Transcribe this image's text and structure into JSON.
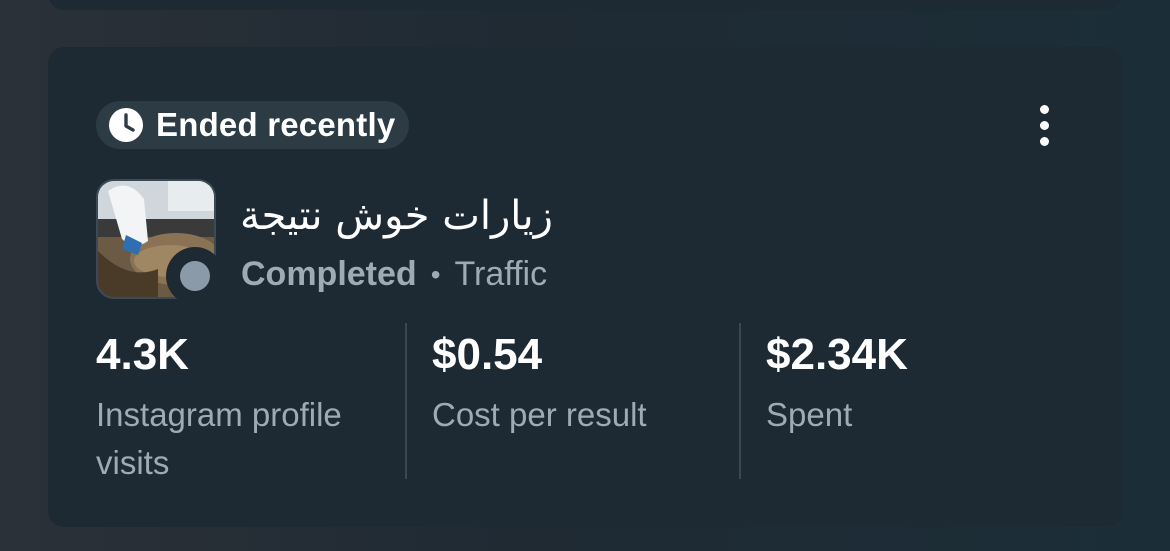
{
  "card": {
    "status_pill": {
      "label": "Ended recently",
      "icon": "clock-icon"
    },
    "menu_icon": "more-vertical-icon",
    "campaign": {
      "name": "زيارات خوش نتيجة",
      "status": "Completed",
      "separator": "•",
      "objective": "Traffic"
    },
    "metrics": [
      {
        "value": "4.3K",
        "label": "Instagram profile visits"
      },
      {
        "value": "$0.54",
        "label": "Cost per result"
      },
      {
        "value": "$2.34K",
        "label": "Spent"
      }
    ]
  },
  "colors": {
    "card_bg": "#1e2a33",
    "pill_bg": "#2d3b45",
    "text_primary": "#ffffff",
    "text_secondary": "#9eaab4",
    "status_dot": "#8a9aa8"
  }
}
